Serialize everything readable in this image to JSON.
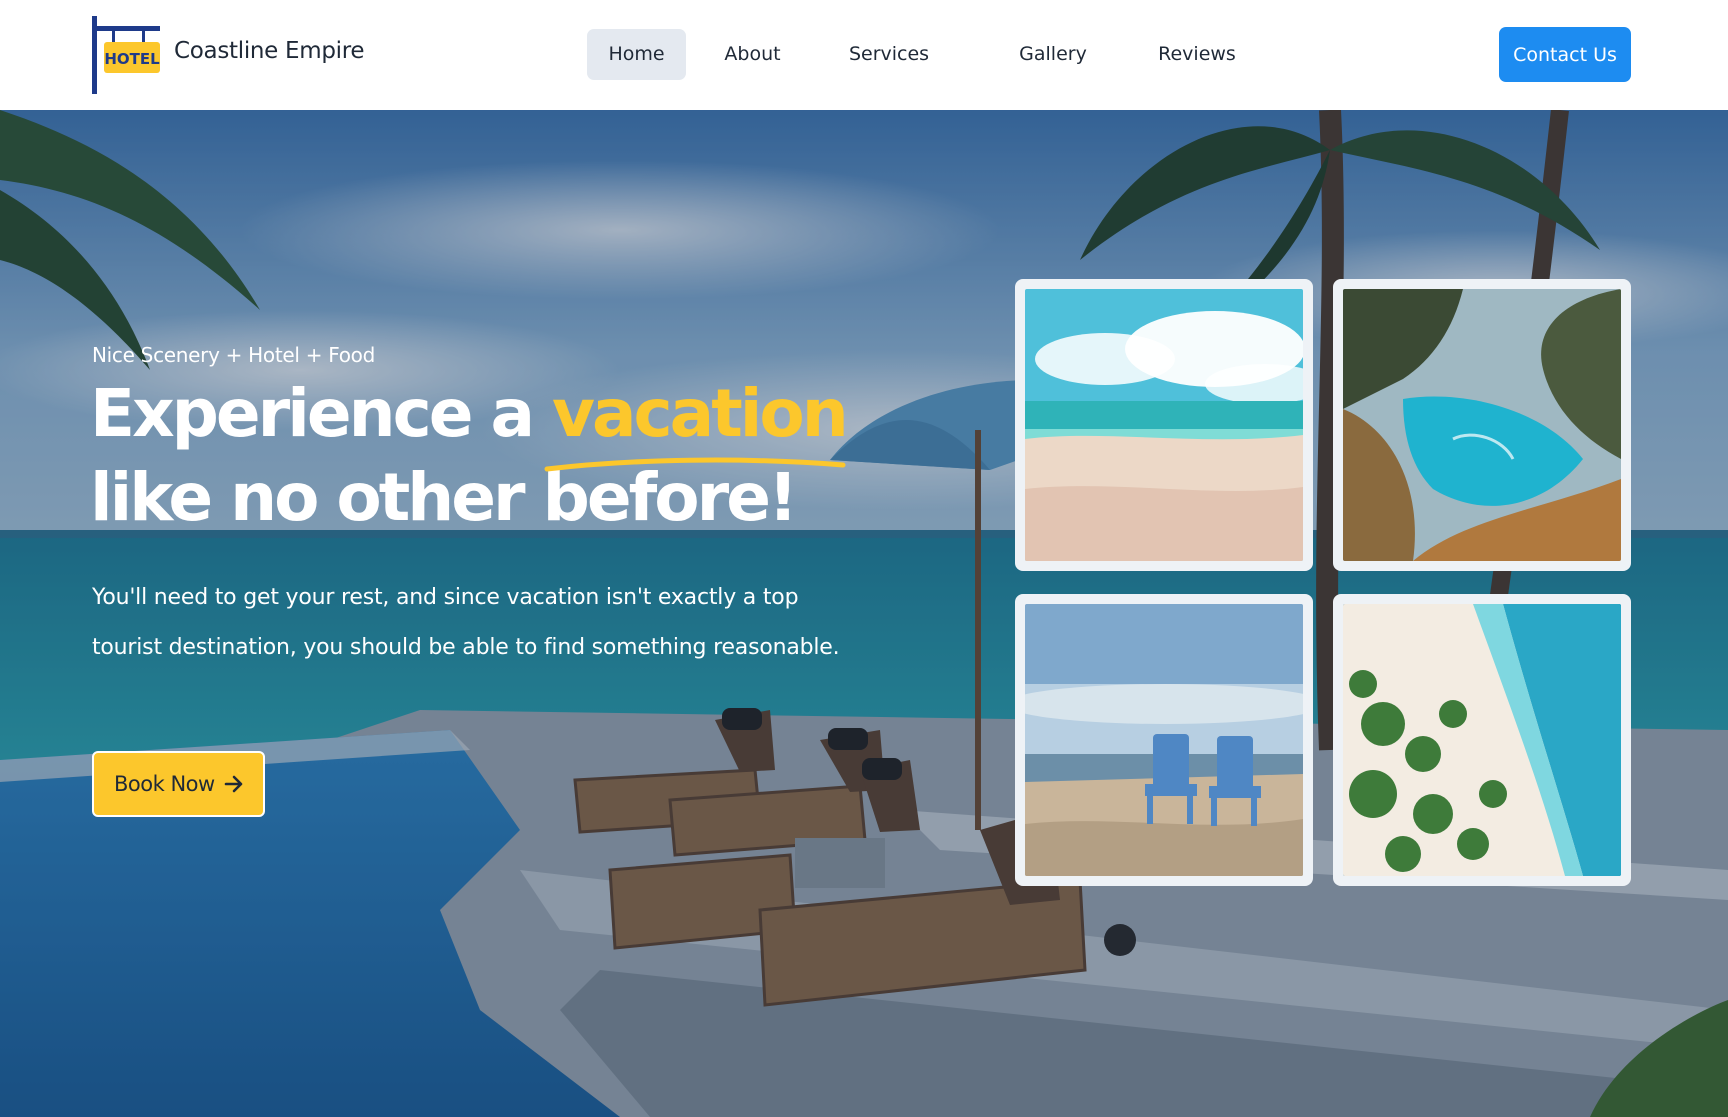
{
  "brand": {
    "name": "Coastline Empire",
    "logo_text": "HOTEL",
    "logo_icon": "hotel-sign-icon"
  },
  "nav": {
    "items": [
      {
        "label": "Home",
        "active": true
      },
      {
        "label": "About",
        "active": false
      },
      {
        "label": "Services",
        "active": false
      },
      {
        "label": "Gallery",
        "active": false
      },
      {
        "label": "Reviews",
        "active": false
      }
    ],
    "contact_label": "Contact Us"
  },
  "hero": {
    "tagline": "Nice Scenery + Hotel + Food",
    "headline_part1": "Experience a ",
    "headline_highlight": "vacation",
    "headline_part2": "like no other before!",
    "description": "You'll need to get your rest, and since vacation isn't exactly a top tourist destination, you should be able to find something reasonable.",
    "book_label": "Book Now",
    "book_icon": "arrow-right-icon"
  },
  "gallery": {
    "images": [
      {
        "name": "beach-clouds-photo"
      },
      {
        "name": "coastal-cove-photo"
      },
      {
        "name": "beach-chairs-photo"
      },
      {
        "name": "aerial-beach-photo"
      }
    ]
  },
  "colors": {
    "accent": "#fcc72c",
    "primary": "#1d8cf1",
    "nav_active_bg": "#e4e9f0",
    "text_dark": "#1f2937"
  }
}
